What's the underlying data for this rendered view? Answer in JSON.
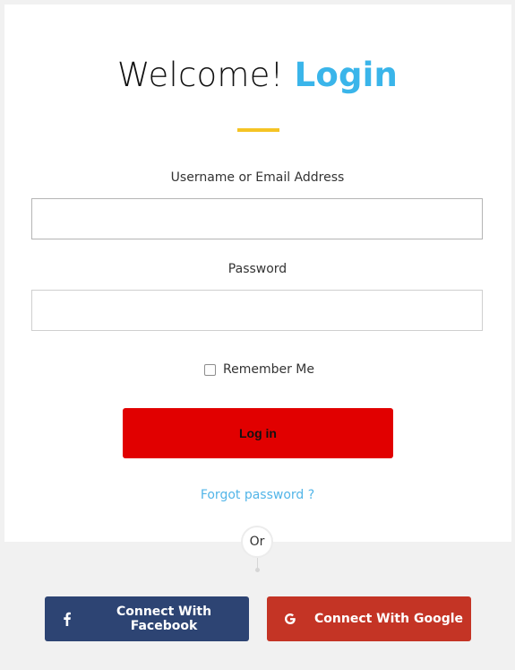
{
  "header": {
    "title_prefix": "Welcome!",
    "title_accent": "Login"
  },
  "form": {
    "username_label": "Username or Email Address",
    "username_value": "",
    "password_label": "Password",
    "password_value": "",
    "remember_label": "Remember Me",
    "remember_checked": false,
    "login_button": "Log in",
    "forgot_link": "Forgot password ?"
  },
  "separator": {
    "or_text": "Or"
  },
  "social": {
    "facebook_label": "Connect With Facebook",
    "facebook_icon": "facebook-icon",
    "google_label": "Connect With Google",
    "google_icon": "google-icon"
  },
  "colors": {
    "accent": "#3ab5ea",
    "divider": "#f5c424",
    "login_button": "#e10000",
    "link": "#52b5e8",
    "facebook": "#2d4473",
    "google": "#c43425"
  }
}
